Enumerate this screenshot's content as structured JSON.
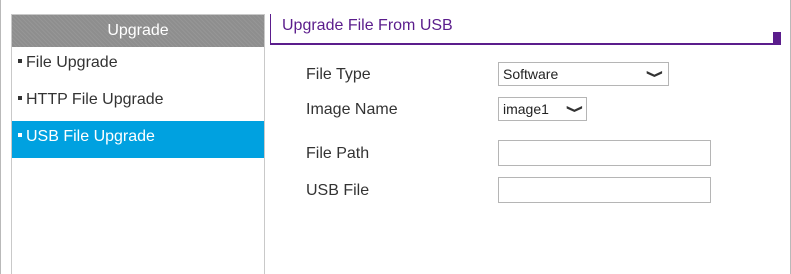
{
  "sidebar": {
    "header": "Upgrade",
    "items": [
      {
        "label": "File Upgrade",
        "active": false
      },
      {
        "label": "HTTP File Upgrade",
        "active": false
      },
      {
        "label": "USB File Upgrade",
        "active": true
      }
    ]
  },
  "main": {
    "title": "Upgrade File From USB",
    "fields": {
      "file_type": {
        "label": "File Type",
        "value": "Software"
      },
      "image_name": {
        "label": "Image Name",
        "value": "image1"
      },
      "file_path": {
        "label": "File Path",
        "value": ""
      },
      "usb_file": {
        "label": "USB File",
        "value": ""
      }
    }
  },
  "colors": {
    "accent_purple": "#5b1d8c",
    "active_item_blue": "#00a1e0",
    "header_gray": "#8e8e8e"
  },
  "icons": {
    "dropdown": "chevron-down-icon",
    "bullet": "bullet-icon"
  }
}
